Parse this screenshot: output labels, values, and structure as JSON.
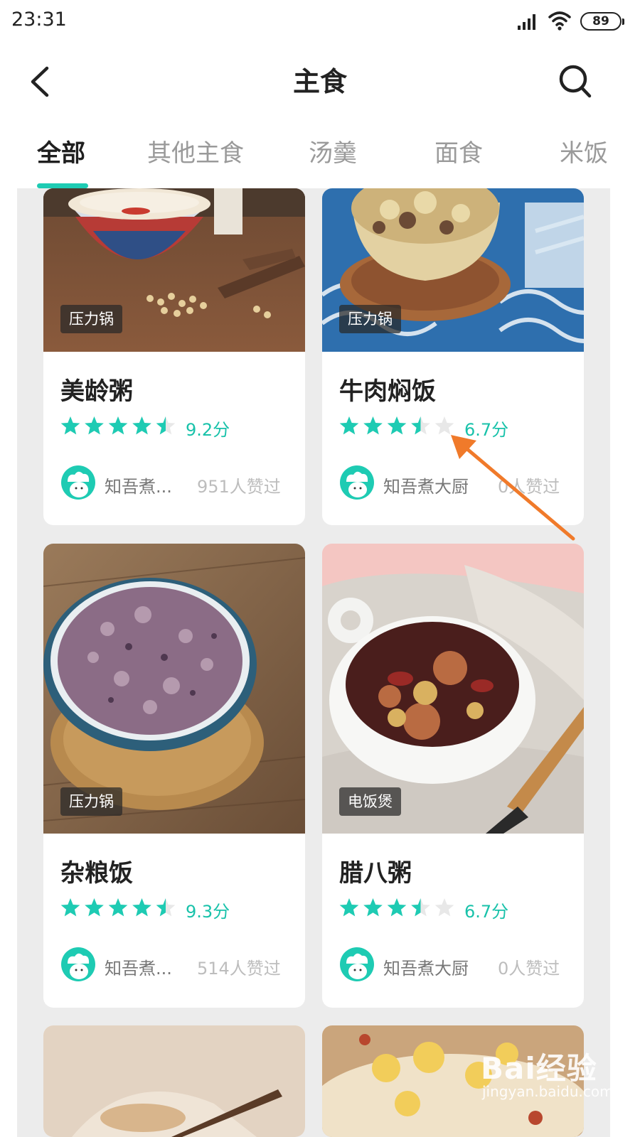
{
  "status_bar": {
    "time": "23:31",
    "battery": "89"
  },
  "header": {
    "title": "主食",
    "back_icon": "chevron-left-icon",
    "search_icon": "search-icon"
  },
  "tabs": [
    {
      "label": "全部",
      "active": true
    },
    {
      "label": "其他主食",
      "active": false
    },
    {
      "label": "汤羹",
      "active": false
    },
    {
      "label": "面食",
      "active": false
    },
    {
      "label": "米饭",
      "active": false
    }
  ],
  "colors": {
    "accent": "#1ecbb3",
    "star_empty": "#e8e8e8",
    "arrow": "#f07a2a"
  },
  "recipes": [
    {
      "title": "美龄粥",
      "tag": "压力锅",
      "rating_stars": 4.5,
      "score": "9.2分",
      "author": "知吾煮...",
      "likes": "951人赞过"
    },
    {
      "title": "牛肉焖饭",
      "tag": "压力锅",
      "rating_stars": 3.5,
      "score": "6.7分",
      "author": "知吾煮大厨",
      "likes": "0人赞过"
    },
    {
      "title": "杂粮饭",
      "tag": "压力锅",
      "rating_stars": 4.5,
      "score": "9.3分",
      "author": "知吾煮...",
      "likes": "514人赞过"
    },
    {
      "title": "腊八粥",
      "tag": "电饭煲",
      "rating_stars": 3.5,
      "score": "6.7分",
      "author": "知吾煮大厨",
      "likes": "0人赞过"
    }
  ],
  "watermark": {
    "brand": "Bai经验",
    "url": "jingyan.baidu.com"
  }
}
